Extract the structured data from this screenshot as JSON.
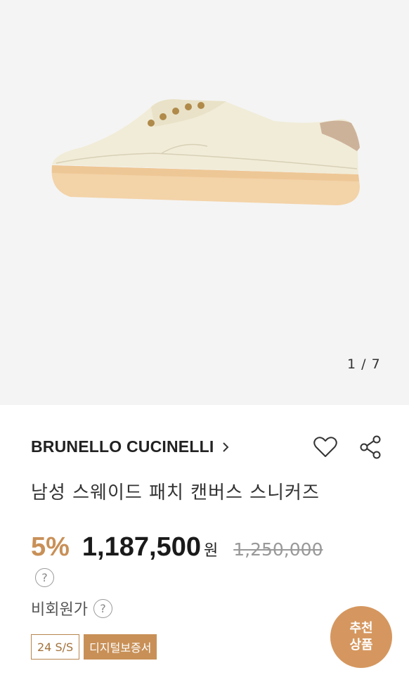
{
  "gallery": {
    "counter": "1 / 7",
    "image_name": "shoe-product-image"
  },
  "product": {
    "brand": "BRUNELLO CUCINELLI",
    "title": "남성 스웨이드 패치 캔버스 스니커즈",
    "discount": "5%",
    "price": "1,187,500",
    "currency": "원",
    "original_price": "1,250,000",
    "help_mark": "?",
    "member_price_label": "비회원가",
    "badges": {
      "season": "24 S/S",
      "digital": "디지털보증서"
    }
  },
  "icons": {
    "heart": "heart-icon",
    "share": "share-icon",
    "chevron": "chevron-right-icon"
  },
  "floating": {
    "line1": "추천",
    "line2": "상품"
  },
  "colors": {
    "accent": "#c89057",
    "gallery_bg": "#f4f4f4"
  }
}
